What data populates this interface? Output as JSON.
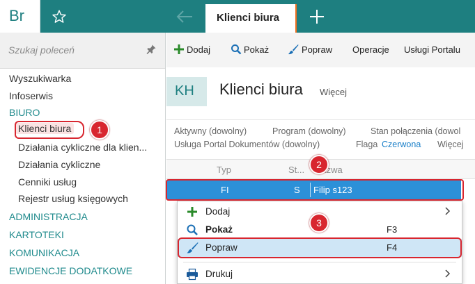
{
  "app": {
    "logo": "Br",
    "active_tab": "Klienci biura",
    "accent": "#1e7f80",
    "selection": "#2c90d8",
    "callout": "#d8262f"
  },
  "icons": {
    "star": "star-icon",
    "back": "arrow-left-icon",
    "new_tab": "plus-icon",
    "pin": "pin-icon"
  },
  "sidebar": {
    "search_placeholder": "Szukaj poleceń",
    "items": [
      {
        "label": "Wyszukiwarka",
        "kind": "item"
      },
      {
        "label": "Infoserwis",
        "kind": "item"
      },
      {
        "label": "BIURO",
        "kind": "section"
      },
      {
        "label": "Klienci biura",
        "kind": "subitem-active"
      },
      {
        "label": "Działania cykliczne dla klien...",
        "kind": "subitem"
      },
      {
        "label": "Działania cykliczne",
        "kind": "subitem"
      },
      {
        "label": "Cenniki usług",
        "kind": "subitem"
      },
      {
        "label": "Rejestr usług księgowych",
        "kind": "subitem"
      },
      {
        "label": "ADMINISTRACJA",
        "kind": "section"
      },
      {
        "label": "KARTOTEKI",
        "kind": "section"
      },
      {
        "label": "KOMUNIKACJA",
        "kind": "section"
      },
      {
        "label": "EWIDENCJE DODATKOWE",
        "kind": "section"
      }
    ]
  },
  "toolbar": {
    "add": "Dodaj",
    "show": "Pokaż",
    "edit": "Popraw",
    "operations": "Operacje",
    "portal": "Usługi Portalu"
  },
  "header": {
    "badge": "KH",
    "title": "Klienci biura",
    "more": "Więcej"
  },
  "filters": {
    "active": "Aktywny (dowolny)",
    "program": "Program (dowolny)",
    "connection": "Stan połączenia (dowol",
    "portal_service": "Usługa Portal Dokumentów (dowolny)",
    "flag_label": "Flaga",
    "flag_value": "Czerwona",
    "more": "Więcej"
  },
  "grid": {
    "columns": [
      "Typ",
      "St...",
      "Nazwa"
    ],
    "rows": [
      {
        "typ": "FI",
        "status": "S",
        "nazwa": "Filip s123"
      }
    ]
  },
  "context_menu": {
    "items": [
      {
        "label": "Dodaj",
        "shortcut": "",
        "submenu": true
      },
      {
        "label": "Pokaż",
        "shortcut": "F3",
        "submenu": false
      },
      {
        "label": "Popraw",
        "shortcut": "F4",
        "submenu": false
      },
      {
        "label": "Drukuj",
        "shortcut": "",
        "submenu": true
      }
    ]
  },
  "callouts": [
    "1",
    "2",
    "3"
  ]
}
